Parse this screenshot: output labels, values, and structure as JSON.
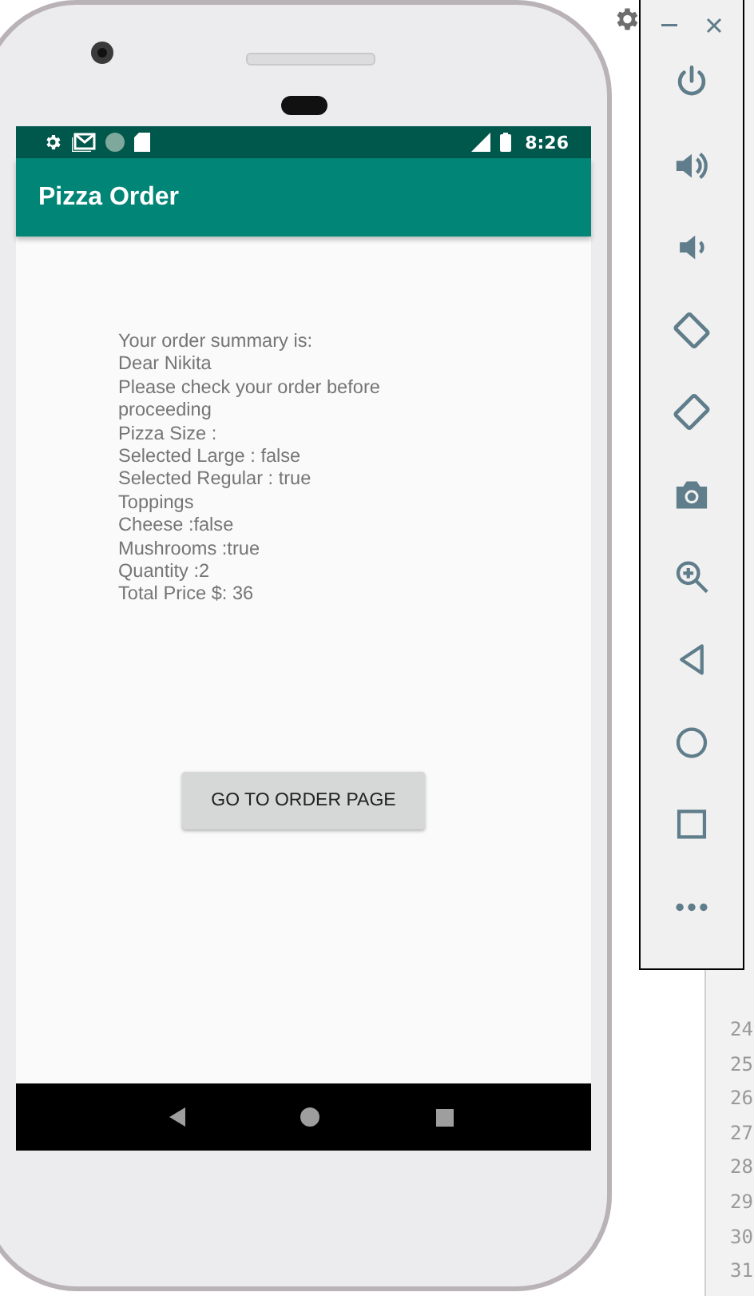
{
  "status_bar": {
    "time": "8:26"
  },
  "app_bar": {
    "title": "Pizza Order"
  },
  "summary_lines": [
    "Your order summary is:",
    "Dear Nikita",
    "Please check your order before proceeding",
    "Pizza Size :",
    "Selected Large : false",
    "Selected Regular : true",
    "Toppings",
    "Cheese :false",
    "Mushrooms :true",
    "Quantity :2",
    "Total Price $: 36"
  ],
  "order_button": {
    "label": "GO TO ORDER PAGE"
  },
  "editor": {
    "line_numbers": [
      "24",
      "25",
      "26",
      "27",
      "28",
      "29",
      "30",
      "31"
    ]
  }
}
